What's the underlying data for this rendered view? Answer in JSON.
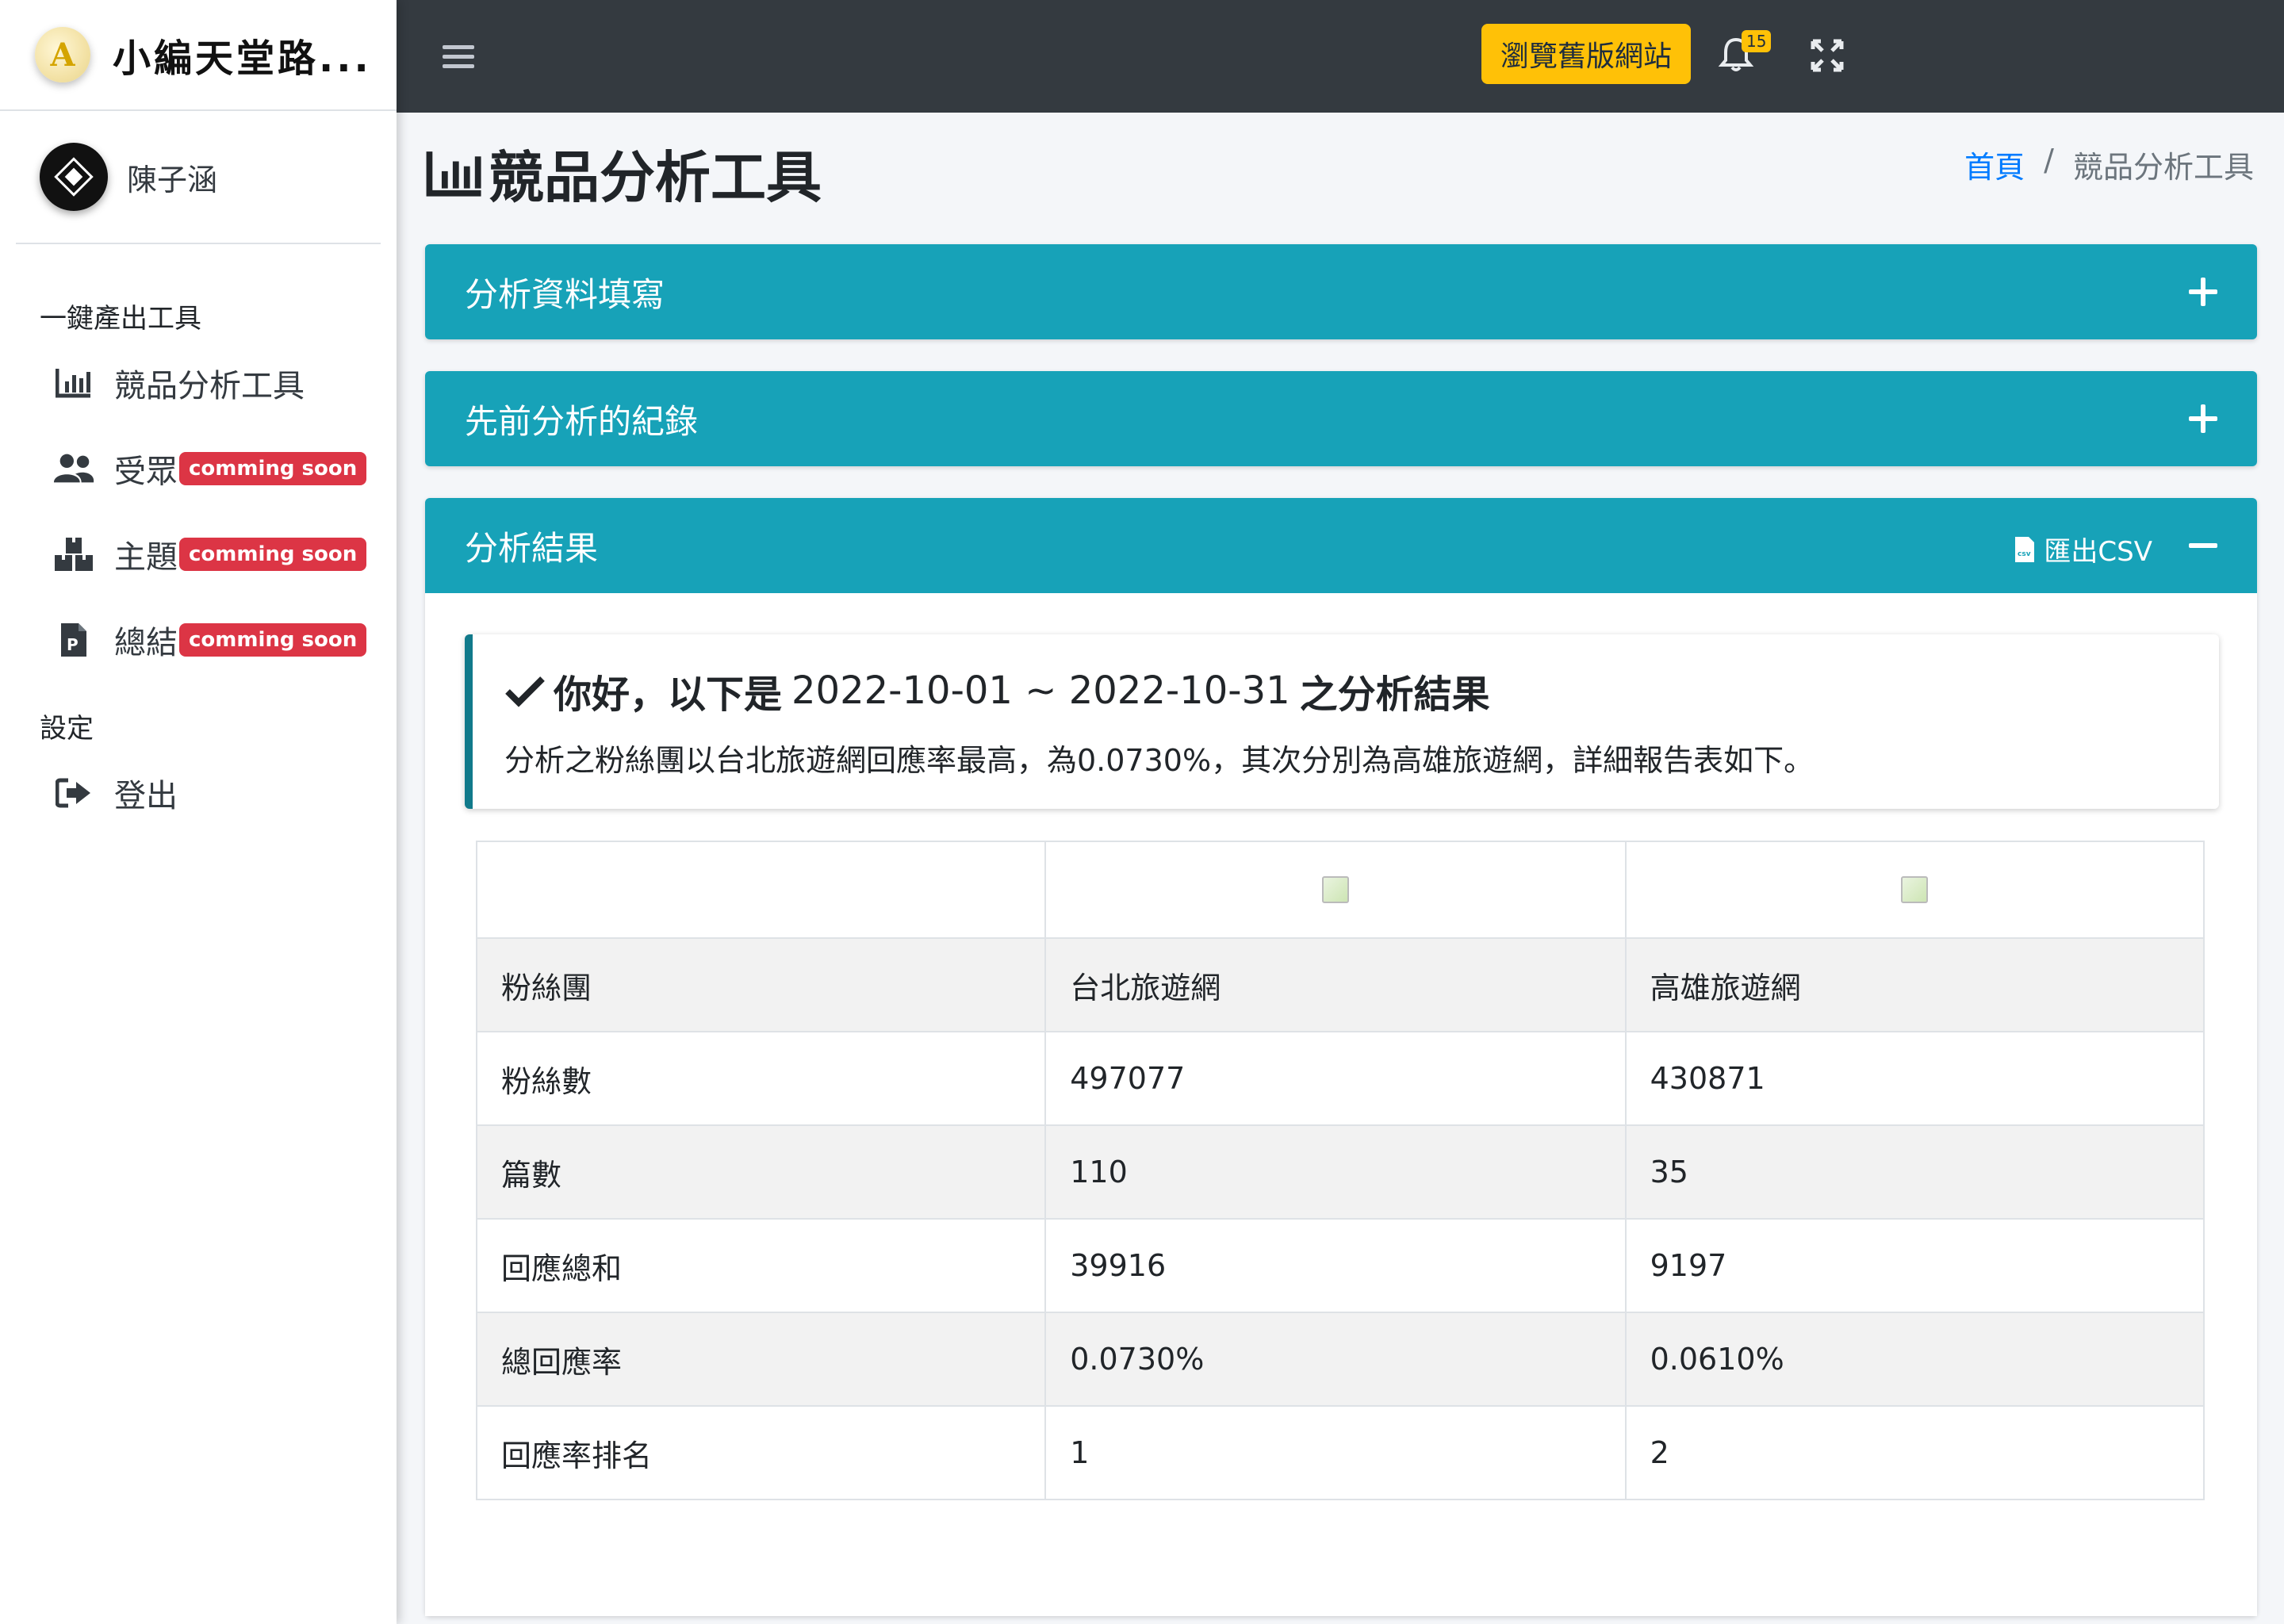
{
  "brand": {
    "name": "小編天堂路..."
  },
  "user": {
    "name": "陳子涵"
  },
  "sidebar": {
    "section1": "一鍵產出工具",
    "items": [
      {
        "label": "競品分析工具",
        "icon": "bar-chart-icon",
        "badge": ""
      },
      {
        "label": "受眾",
        "icon": "users-icon",
        "badge": "comming soon"
      },
      {
        "label": "主題",
        "icon": "boxes-icon",
        "badge": "comming soon"
      },
      {
        "label": "總結",
        "icon": "file-p-icon",
        "badge": "comming soon"
      }
    ],
    "section2": "設定",
    "logout": "登出"
  },
  "topbar": {
    "old_site_button": "瀏覽舊版網站",
    "notification_count": "15"
  },
  "page": {
    "title": "競品分析工具",
    "breadcrumb": {
      "home": "首頁",
      "sep": "/",
      "current": "競品分析工具"
    }
  },
  "cards": {
    "form": {
      "title": "分析資料填寫"
    },
    "history": {
      "title": "先前分析的紀錄"
    },
    "result": {
      "title": "分析結果",
      "export_label": "匯出CSV"
    }
  },
  "callout": {
    "greeting": "你好，以下是",
    "date_range": "2022-10-01 ~ 2022-10-31",
    "suffix": "之分析結果",
    "text": "分析之粉絲團以台北旅遊網回應率最高，為0.0730%，其次分別為高雄旅遊網，詳細報告表如下。"
  },
  "table": {
    "rows": [
      {
        "label": "粉絲團",
        "a": "台北旅遊網",
        "b": "高雄旅遊網"
      },
      {
        "label": "粉絲數",
        "a": "497077",
        "b": "430871"
      },
      {
        "label": "篇數",
        "a": "110",
        "b": "35"
      },
      {
        "label": "回應總和",
        "a": "39916",
        "b": "9197"
      },
      {
        "label": "總回應率",
        "a": "0.0730%",
        "b": "0.0610%"
      },
      {
        "label": "回應率排名",
        "a": "1",
        "b": "2"
      }
    ]
  },
  "colors": {
    "topbar": "#343a40",
    "card_header": "#17a2b8",
    "badge": "#dc3545",
    "warning": "#ffc107",
    "link": "#007bff"
  }
}
